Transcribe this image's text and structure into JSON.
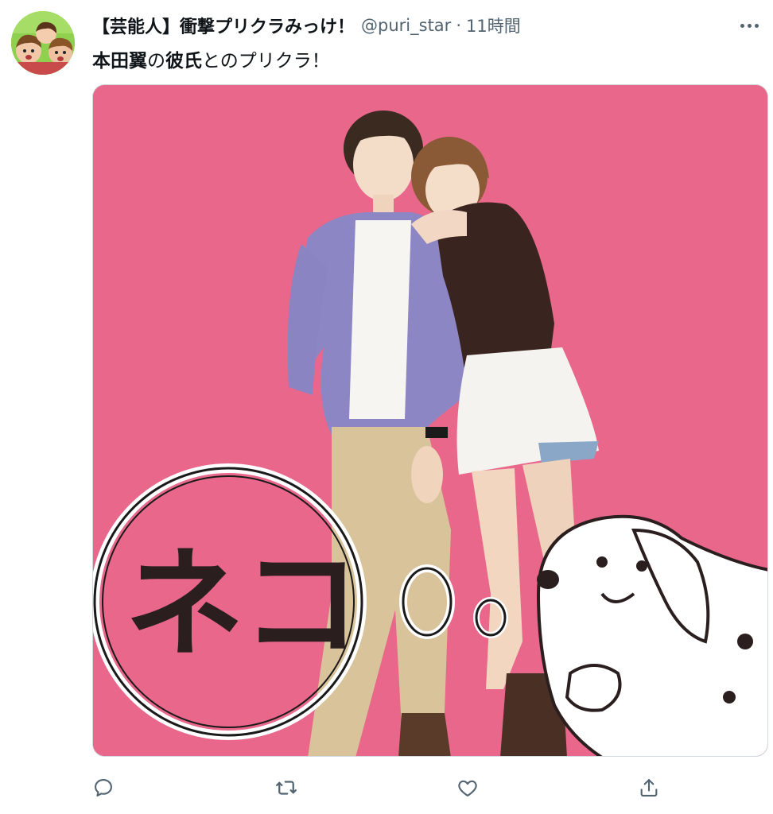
{
  "tweet": {
    "display_name": "【芸能人】衝撃プリクラみっけ！",
    "handle": "@puri_star",
    "separator": "·",
    "timestamp": "11時間",
    "text_bold_1": "本田翼",
    "text_plain_1": "の",
    "text_bold_2": "彼氏",
    "text_plain_2": "とのプリクラ！"
  },
  "media": {
    "background_color": "#e8678b",
    "handwritten_text": "ネコ"
  },
  "actions": {
    "reply_icon": "reply-icon",
    "retweet_icon": "retweet-icon",
    "like_icon": "heart-icon",
    "share_icon": "share-icon"
  },
  "colors": {
    "text_primary": "#0f1419",
    "text_secondary": "#536471",
    "border": "#cfd9de"
  }
}
